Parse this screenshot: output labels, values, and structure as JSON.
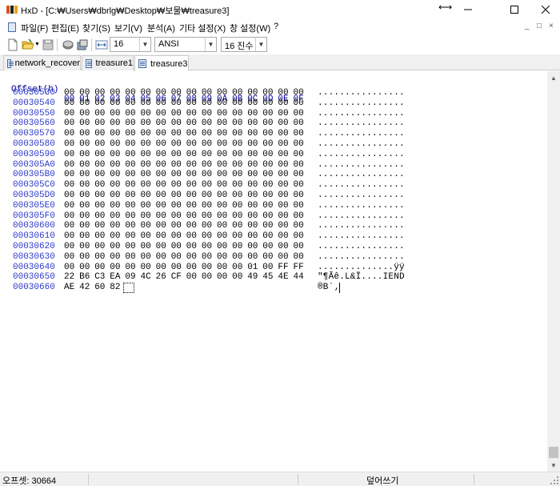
{
  "window": {
    "title": "HxD - [C:₩Users₩dbrlg₩Desktop₩보물₩treasure3]",
    "minimize_icon": "minimize-icon",
    "maximize_icon": "maximize-icon",
    "close_icon": "close-icon"
  },
  "menu": {
    "items": [
      "파일(F)",
      "편집(E)",
      "찾기(S)",
      "보기(V)",
      "분석(A)",
      "기타 설정(X)",
      "창 설정(W)",
      "?"
    ],
    "mdi_buttons": [
      "_",
      "□",
      "×"
    ]
  },
  "toolbar": {
    "bytes_per_row": "16",
    "charset": "ANSI",
    "offset_base": "16 진수"
  },
  "tabs": [
    "network_recover",
    "treasure1",
    "treasure3"
  ],
  "active_tab": 2,
  "editor": {
    "header_label": "Offset(h)",
    "header_cols": [
      "00",
      "01",
      "02",
      "03",
      "04",
      "05",
      "06",
      "07",
      "08",
      "09",
      "0A",
      "0B",
      "0C",
      "0D",
      "0E",
      "0F"
    ],
    "rows": [
      {
        "offset": "00030530",
        "hex": [
          "00",
          "00",
          "00",
          "00",
          "00",
          "00",
          "00",
          "00",
          "00",
          "00",
          "00",
          "00",
          "00",
          "00",
          "00",
          "00"
        ],
        "ascii": "................"
      },
      {
        "offset": "00030540",
        "hex": [
          "00",
          "00",
          "00",
          "00",
          "00",
          "00",
          "00",
          "00",
          "00",
          "00",
          "00",
          "00",
          "00",
          "00",
          "00",
          "00"
        ],
        "ascii": "................"
      },
      {
        "offset": "00030550",
        "hex": [
          "00",
          "00",
          "00",
          "00",
          "00",
          "00",
          "00",
          "00",
          "00",
          "00",
          "00",
          "00",
          "00",
          "00",
          "00",
          "00"
        ],
        "ascii": "................"
      },
      {
        "offset": "00030560",
        "hex": [
          "00",
          "00",
          "00",
          "00",
          "00",
          "00",
          "00",
          "00",
          "00",
          "00",
          "00",
          "00",
          "00",
          "00",
          "00",
          "00"
        ],
        "ascii": "................"
      },
      {
        "offset": "00030570",
        "hex": [
          "00",
          "00",
          "00",
          "00",
          "00",
          "00",
          "00",
          "00",
          "00",
          "00",
          "00",
          "00",
          "00",
          "00",
          "00",
          "00"
        ],
        "ascii": "................"
      },
      {
        "offset": "00030580",
        "hex": [
          "00",
          "00",
          "00",
          "00",
          "00",
          "00",
          "00",
          "00",
          "00",
          "00",
          "00",
          "00",
          "00",
          "00",
          "00",
          "00"
        ],
        "ascii": "................"
      },
      {
        "offset": "00030590",
        "hex": [
          "00",
          "00",
          "00",
          "00",
          "00",
          "00",
          "00",
          "00",
          "00",
          "00",
          "00",
          "00",
          "00",
          "00",
          "00",
          "00"
        ],
        "ascii": "................"
      },
      {
        "offset": "000305A0",
        "hex": [
          "00",
          "00",
          "00",
          "00",
          "00",
          "00",
          "00",
          "00",
          "00",
          "00",
          "00",
          "00",
          "00",
          "00",
          "00",
          "00"
        ],
        "ascii": "................"
      },
      {
        "offset": "000305B0",
        "hex": [
          "00",
          "00",
          "00",
          "00",
          "00",
          "00",
          "00",
          "00",
          "00",
          "00",
          "00",
          "00",
          "00",
          "00",
          "00",
          "00"
        ],
        "ascii": "................"
      },
      {
        "offset": "000305C0",
        "hex": [
          "00",
          "00",
          "00",
          "00",
          "00",
          "00",
          "00",
          "00",
          "00",
          "00",
          "00",
          "00",
          "00",
          "00",
          "00",
          "00"
        ],
        "ascii": "................"
      },
      {
        "offset": "000305D0",
        "hex": [
          "00",
          "00",
          "00",
          "00",
          "00",
          "00",
          "00",
          "00",
          "00",
          "00",
          "00",
          "00",
          "00",
          "00",
          "00",
          "00"
        ],
        "ascii": "................"
      },
      {
        "offset": "000305E0",
        "hex": [
          "00",
          "00",
          "00",
          "00",
          "00",
          "00",
          "00",
          "00",
          "00",
          "00",
          "00",
          "00",
          "00",
          "00",
          "00",
          "00"
        ],
        "ascii": "................"
      },
      {
        "offset": "000305F0",
        "hex": [
          "00",
          "00",
          "00",
          "00",
          "00",
          "00",
          "00",
          "00",
          "00",
          "00",
          "00",
          "00",
          "00",
          "00",
          "00",
          "00"
        ],
        "ascii": "................"
      },
      {
        "offset": "00030600",
        "hex": [
          "00",
          "00",
          "00",
          "00",
          "00",
          "00",
          "00",
          "00",
          "00",
          "00",
          "00",
          "00",
          "00",
          "00",
          "00",
          "00"
        ],
        "ascii": "................"
      },
      {
        "offset": "00030610",
        "hex": [
          "00",
          "00",
          "00",
          "00",
          "00",
          "00",
          "00",
          "00",
          "00",
          "00",
          "00",
          "00",
          "00",
          "00",
          "00",
          "00"
        ],
        "ascii": "................"
      },
      {
        "offset": "00030620",
        "hex": [
          "00",
          "00",
          "00",
          "00",
          "00",
          "00",
          "00",
          "00",
          "00",
          "00",
          "00",
          "00",
          "00",
          "00",
          "00",
          "00"
        ],
        "ascii": "................"
      },
      {
        "offset": "00030630",
        "hex": [
          "00",
          "00",
          "00",
          "00",
          "00",
          "00",
          "00",
          "00",
          "00",
          "00",
          "00",
          "00",
          "00",
          "00",
          "00",
          "00"
        ],
        "ascii": "................"
      },
      {
        "offset": "00030640",
        "hex": [
          "00",
          "00",
          "00",
          "00",
          "00",
          "00",
          "00",
          "00",
          "00",
          "00",
          "00",
          "00",
          "01",
          "00",
          "FF",
          "FF"
        ],
        "ascii": "..............ÿÿ"
      },
      {
        "offset": "00030650",
        "hex": [
          "22",
          "B6",
          "C3",
          "EA",
          "09",
          "4C",
          "26",
          "CF",
          "00",
          "00",
          "00",
          "00",
          "49",
          "45",
          "4E",
          "44"
        ],
        "ascii": "\"¶Ãê.L&Ï....IEND"
      },
      {
        "offset": "00030660",
        "hex": [
          "AE",
          "42",
          "60",
          "82"
        ],
        "ascii": "®B`‚"
      }
    ]
  },
  "status": {
    "offset": "오프셋: 30664",
    "mode": "덮어쓰기"
  }
}
